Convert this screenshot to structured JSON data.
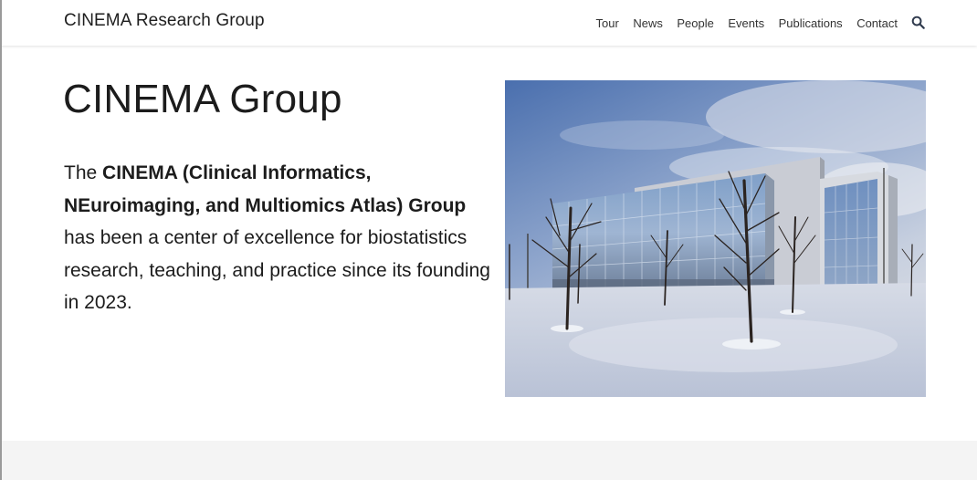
{
  "site": {
    "brand": "CINEMA Research Group"
  },
  "nav": {
    "items": [
      {
        "label": "Tour"
      },
      {
        "label": "News"
      },
      {
        "label": "People"
      },
      {
        "label": "Events"
      },
      {
        "label": "Publications"
      },
      {
        "label": "Contact"
      }
    ],
    "search_icon": "search-icon"
  },
  "hero": {
    "title": "CINEMA Group",
    "intro_prefix": "The ",
    "intro_bold": "CINEMA (Clinical Informatics, NEuroimaging, and Multiomics Atlas) Group",
    "intro_rest": " has been a center of excellence for biostatistics research, teaching, and practice since its founding in 2023."
  },
  "colors": {
    "text": "#1c1c1c",
    "nav_text": "#333333",
    "footer_band": "#f4f4f4"
  }
}
